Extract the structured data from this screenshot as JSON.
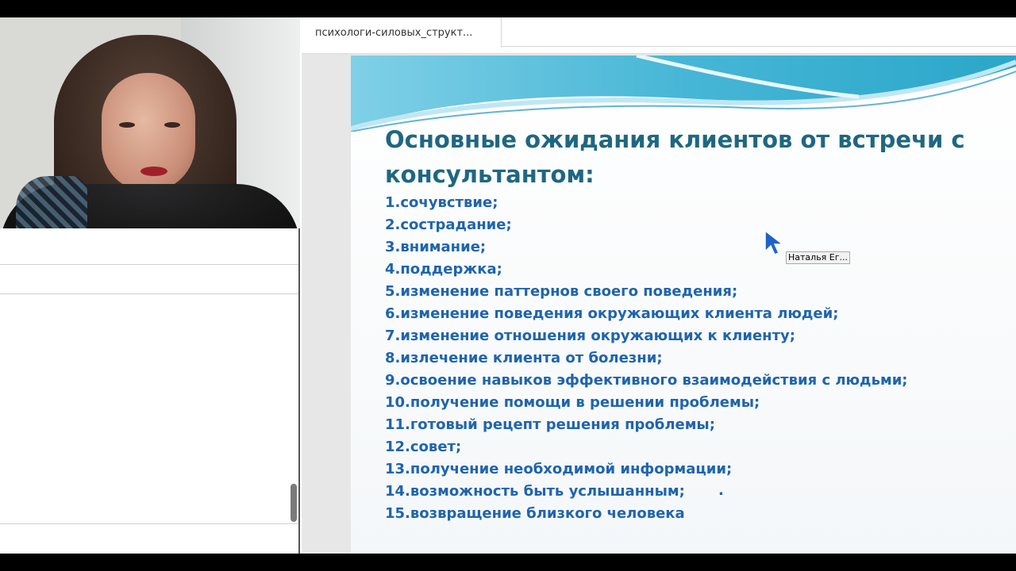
{
  "document_tab": {
    "title": "психологи-силовых_структ..."
  },
  "slide": {
    "title": "Основные ожидания клиентов от встречи с консультантом:",
    "items": [
      "1.сочувствие;",
      "2.сострадание;",
      "3.внимание;",
      "4.поддержка;",
      "5.изменение паттернов своего поведения;",
      "6.изменение поведения окружающих клиента людей;",
      "7.изменение отношения окружающих к клиенту;",
      "8.излечение клиента от болезни;",
      "9.освоение навыков эффективного взаимодействия с людьми;",
      "10.получение помощи в решении проблемы;",
      "11.готовый рецепт решения проблемы;",
      "12.совет;",
      "13.получение необходимой информации;",
      "14.возможность быть услышанным;",
      "15.возвращение близкого человека"
    ],
    "stray_mark": "."
  },
  "pointer": {
    "label": "Наталья Ег..."
  },
  "colors": {
    "title": "#1f6781",
    "items": "#1f64ac",
    "wave_dark": "#2aa7c9",
    "wave_light": "#bfe7f3"
  }
}
